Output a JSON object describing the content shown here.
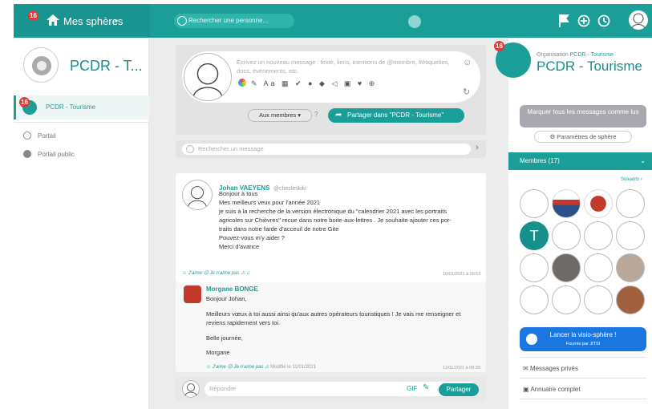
{
  "topbar": {
    "badge": "16",
    "spheres_label": "Mes sphères",
    "search_placeholder": "Rechercher une personne..."
  },
  "left": {
    "sphere_title": "PCDR - T...",
    "active_badge": "16",
    "active_item": "PCDR - Tourisme",
    "links": [
      "Portail",
      "Portail public"
    ]
  },
  "composer": {
    "placeholder": "Écrivez un nouveau message : texte, liens, mentions de @membre, #étiquettes, docs, événements, etc.",
    "members_button": "Aux membres",
    "share_button": "Partager dans \"PCDR - Tourisme\""
  },
  "search_message_placeholder": "Rechercher un message",
  "post": {
    "author": "Johan VAEYENS",
    "handle": "@chezleskiki",
    "lines": [
      "Bonjour à tous",
      "Mes meilleurs veux pour l'année 2021",
      "je suis à la recherche de la version électronique du \"calendrier 2021 avec les portraits",
      "agricoles sur Chièvres\" recue dans notre boite-aux-lettres . Je souhaite ajouter ces por-",
      "traits dans notre farde d'acceuil de notre Gite",
      "Pouvez-vous m'y aider ?",
      "Merci d'avance"
    ],
    "like": "J'aime",
    "dislike": "Je n'aime pas",
    "date": "10/01/2021 à 09:53"
  },
  "reply": {
    "author": "Morgane BONGE",
    "lines": [
      "Bonjour Johan,",
      "Meilleurs vœux à toi aussi ainsi qu'aux autres opérateurs touristiques ! Je vais me renseigner et",
      "reviens rapidement vers toi.",
      "Belle journée,",
      "Morgane"
    ],
    "like": "J'aime",
    "dislike": "Je n'aime pas",
    "modified": "Modifié le 11/01/2021",
    "date": "11/01/2021 à 08:39"
  },
  "replybox": {
    "placeholder": "Répondre",
    "gif": "GIF",
    "submit": "Partager"
  },
  "right": {
    "badge": "16",
    "org_prefix": "Organisation ",
    "org_name": "PCDR - Tourisme",
    "title": "PCDR - Tourisme",
    "mark_read": "Marquer tous les messages comme lus",
    "settings": "Paramètres de sphère",
    "members_label": "Membres (17)",
    "next": "Suivants",
    "member_T": "T",
    "visio_title": "Lancer la visio-sphère !",
    "visio_sub": "Fournie par JITSI",
    "links": [
      "Messages privés",
      "Annuaire complet"
    ]
  },
  "colors": {
    "accent": "#1a9e97",
    "visio": "#1b76e0",
    "badge": "#e03b3b"
  }
}
